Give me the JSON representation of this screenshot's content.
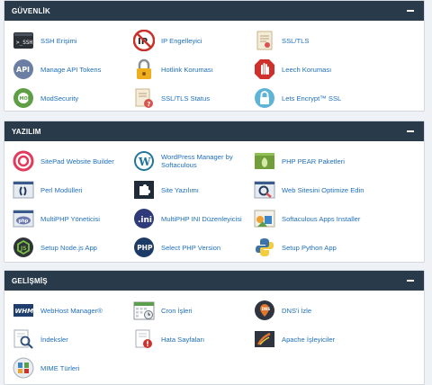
{
  "sections": [
    {
      "title": "GÜVENLİK",
      "items": [
        {
          "label": "SSH Erişimi",
          "icon": "terminal-icon"
        },
        {
          "label": "IP Engelleyici",
          "icon": "ip-blocker-icon"
        },
        {
          "label": "SSL/TLS",
          "icon": "certificate-icon"
        },
        {
          "label": "Manage API Tokens",
          "icon": "api-icon"
        },
        {
          "label": "Hotlink Koruması",
          "icon": "padlock-icon"
        },
        {
          "label": "Leech Koruması",
          "icon": "hand-stop-icon"
        },
        {
          "label": "ModSecurity",
          "icon": "modsecurity-icon"
        },
        {
          "label": "SSL/TLS Status",
          "icon": "certificate-warning-icon"
        },
        {
          "label": "Lets Encrypt™ SSL",
          "icon": "lets-encrypt-icon"
        }
      ]
    },
    {
      "title": "YAZILIM",
      "items": [
        {
          "label": "SitePad Website Builder",
          "icon": "sitepad-icon"
        },
        {
          "label": "WordPress Manager by Softaculous",
          "icon": "wordpress-icon"
        },
        {
          "label": "PHP PEAR Paketleri",
          "icon": "pear-icon"
        },
        {
          "label": "Perl Modülleri",
          "icon": "perl-icon"
        },
        {
          "label": "Site Yazılımı",
          "icon": "puzzle-icon"
        },
        {
          "label": "Web Sitesini Optimize Edin",
          "icon": "optimize-icon"
        },
        {
          "label": "MultiPHP Yöneticisi",
          "icon": "multiphp-icon"
        },
        {
          "label": "MultiPHP INI Düzenleyicisi",
          "icon": "ini-icon"
        },
        {
          "label": "Softaculous Apps Installer",
          "icon": "softaculous-icon"
        },
        {
          "label": "Setup Node.js App",
          "icon": "nodejs-icon"
        },
        {
          "label": "Select PHP Version",
          "icon": "php-icon"
        },
        {
          "label": "Setup Python App",
          "icon": "python-icon"
        }
      ]
    },
    {
      "title": "GELİŞMİŞ",
      "items": [
        {
          "label": "WebHost Manager®",
          "icon": "whm-icon"
        },
        {
          "label": "Cron İşleri",
          "icon": "calendar-icon"
        },
        {
          "label": "DNS'i İzle",
          "icon": "dns-icon"
        },
        {
          "label": "İndeksler",
          "icon": "index-search-icon"
        },
        {
          "label": "Hata Sayfaları",
          "icon": "error-page-icon"
        },
        {
          "label": "Apache İşleyiciler",
          "icon": "apache-handler-icon"
        },
        {
          "label": "MIME Türleri",
          "icon": "mime-icon"
        }
      ]
    }
  ]
}
